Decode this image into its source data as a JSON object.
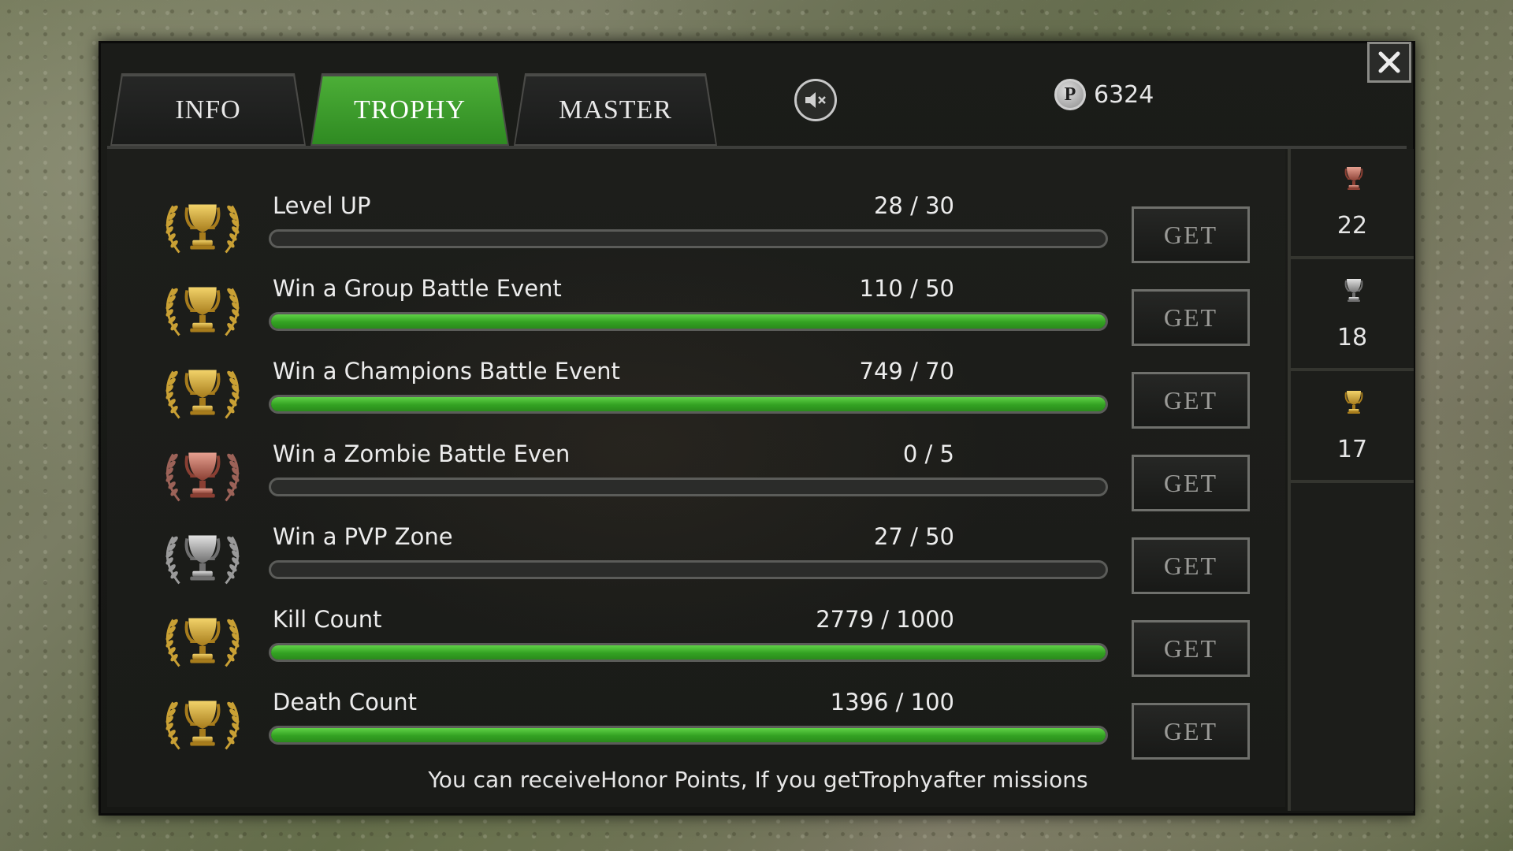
{
  "tabs": [
    {
      "label": "INFO",
      "active": false
    },
    {
      "label": "TROPHY",
      "active": true
    },
    {
      "label": "MASTER",
      "active": false
    }
  ],
  "header": {
    "mute_icon": "speaker-muted-icon",
    "points_icon_letter": "P",
    "points_value": "6324",
    "close_icon": "close-icon"
  },
  "missions": [
    {
      "label": "Level UP",
      "progress": "28 / 30",
      "fill": 0,
      "tier": "gold",
      "button": "GET"
    },
    {
      "label": "Win a Group Battle Event",
      "progress": "110 / 50",
      "fill": 1,
      "tier": "gold",
      "button": "GET"
    },
    {
      "label": "Win a Champions Battle Event",
      "progress": "749 / 70",
      "fill": 1,
      "tier": "gold",
      "button": "GET"
    },
    {
      "label": "Win a Zombie Battle Even",
      "progress": "0 / 5",
      "fill": 0,
      "tier": "bronze",
      "button": "GET"
    },
    {
      "label": "Win a PVP Zone",
      "progress": "27 / 50",
      "fill": 0,
      "tier": "silver",
      "button": "GET"
    },
    {
      "label": "Kill Count",
      "progress": "2779 / 1000",
      "fill": 1,
      "tier": "gold",
      "button": "GET"
    },
    {
      "label": "Death Count",
      "progress": "1396 / 100",
      "fill": 1,
      "tier": "gold",
      "button": "GET"
    }
  ],
  "footer": {
    "message": "You can receiveHonor Points, If you getTrophyafter missions"
  },
  "trophy_counts": [
    {
      "tier": "bronze",
      "count": "22"
    },
    {
      "tier": "silver",
      "count": "18"
    },
    {
      "tier": "gold",
      "count": "17"
    }
  ],
  "colors": {
    "accent_green": "#3b9e2a",
    "gold": "#d8b040",
    "silver": "#b4b4b4",
    "bronze": "#c07060"
  }
}
